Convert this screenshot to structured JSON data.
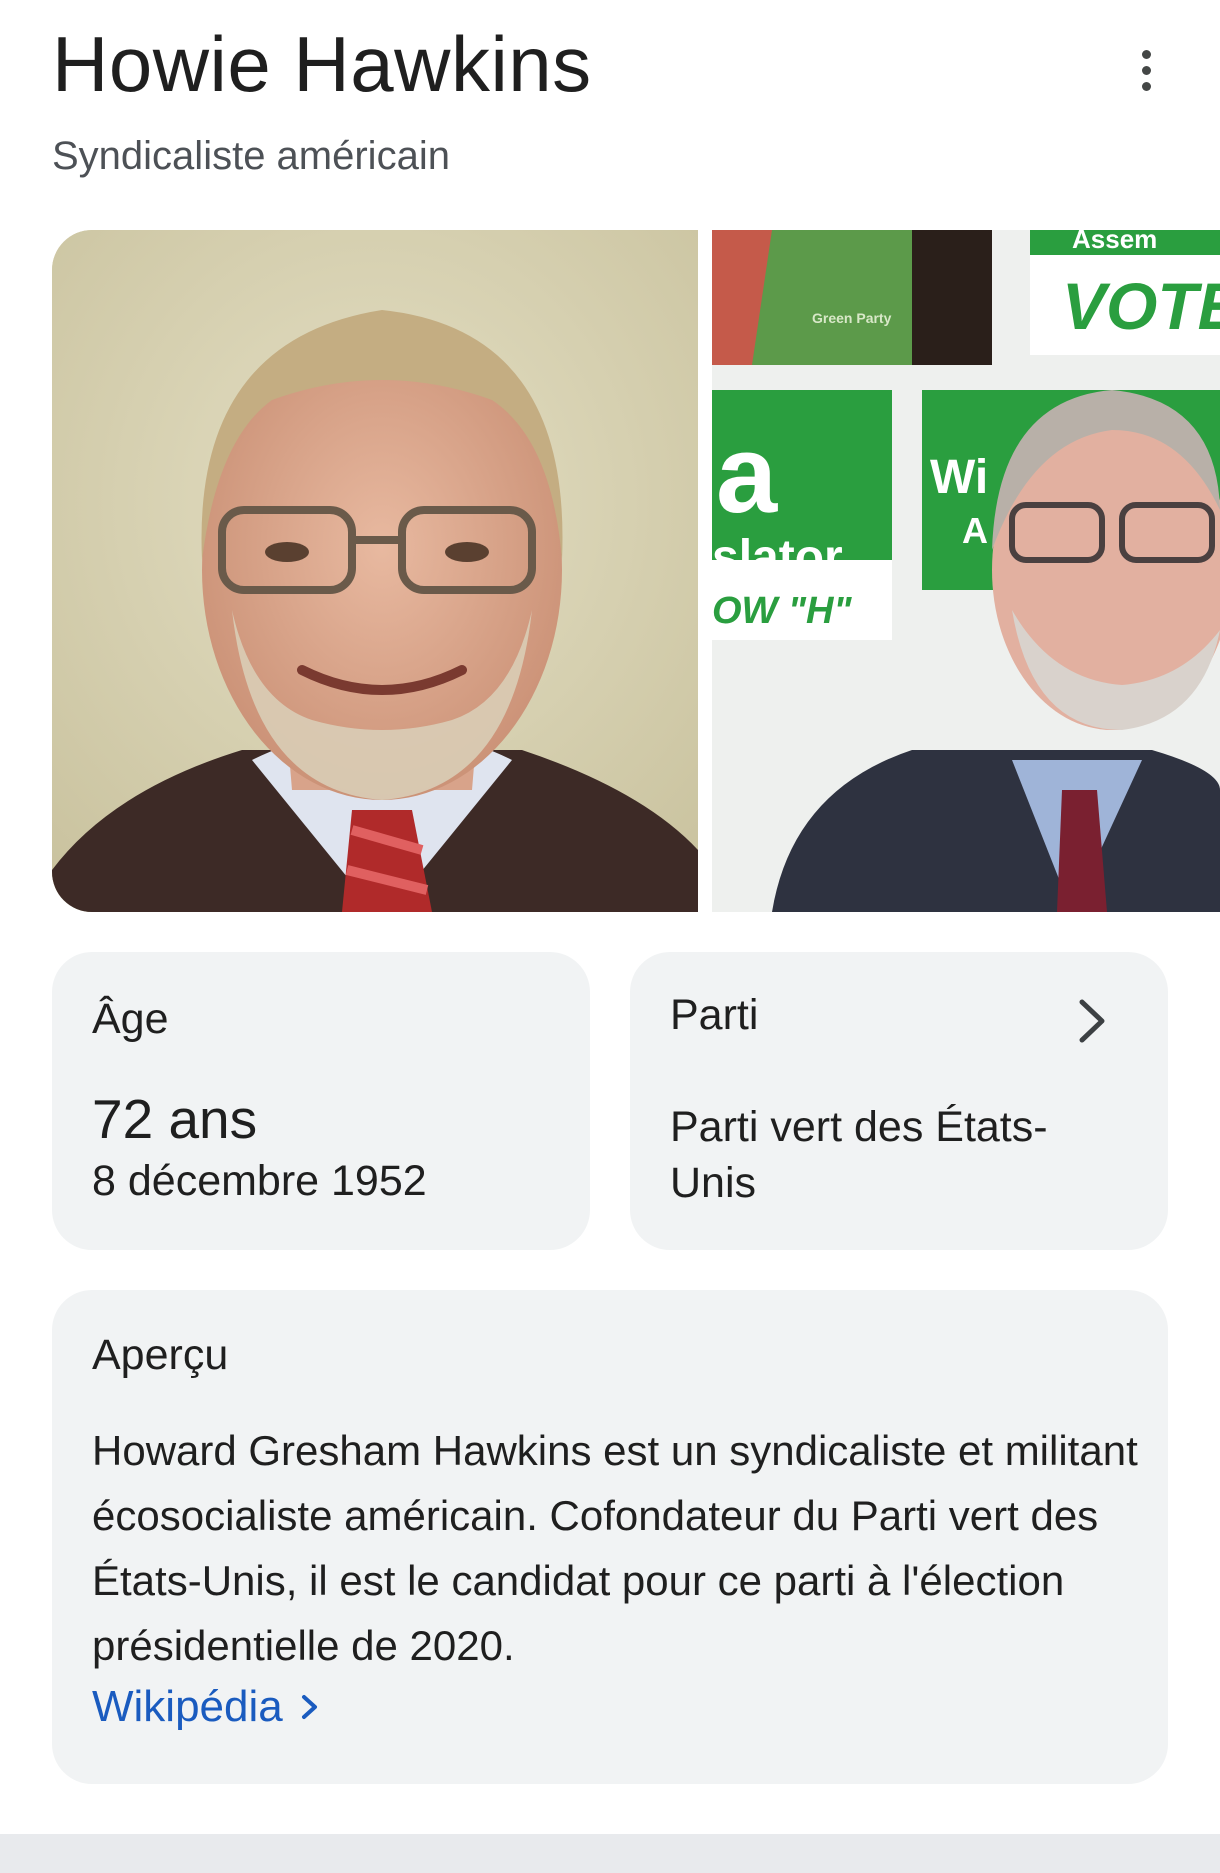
{
  "header": {
    "title": "Howie Hawkins",
    "subtitle": "Syndicaliste américain"
  },
  "icons": {
    "more": "more-vert-icon",
    "chevron": "chevron-right-icon"
  },
  "photos": {
    "second_photo_sign_texts": [
      "Assem",
      "VOTE",
      "a",
      "slator",
      "OW \"H\"",
      "Wi",
      "A",
      "Green Party"
    ]
  },
  "age_card": {
    "label": "Âge",
    "value": "72 ans",
    "date": "8 décembre 1952"
  },
  "party_card": {
    "label": "Parti",
    "value": "Parti vert des États-Unis"
  },
  "overview": {
    "label": "Aperçu",
    "text": "Howard Gresham Hawkins est un syndicaliste et militant écosocialiste américain. Cofondateur du Parti vert des États-Unis, il est le candidat pour ce parti à l'élection présidentielle de 2020.",
    "link_label": "Wikipédia"
  },
  "colors": {
    "card_bg": "#f1f3f4",
    "link": "#1a5bbf",
    "green_sign": "#2a9e3f"
  }
}
